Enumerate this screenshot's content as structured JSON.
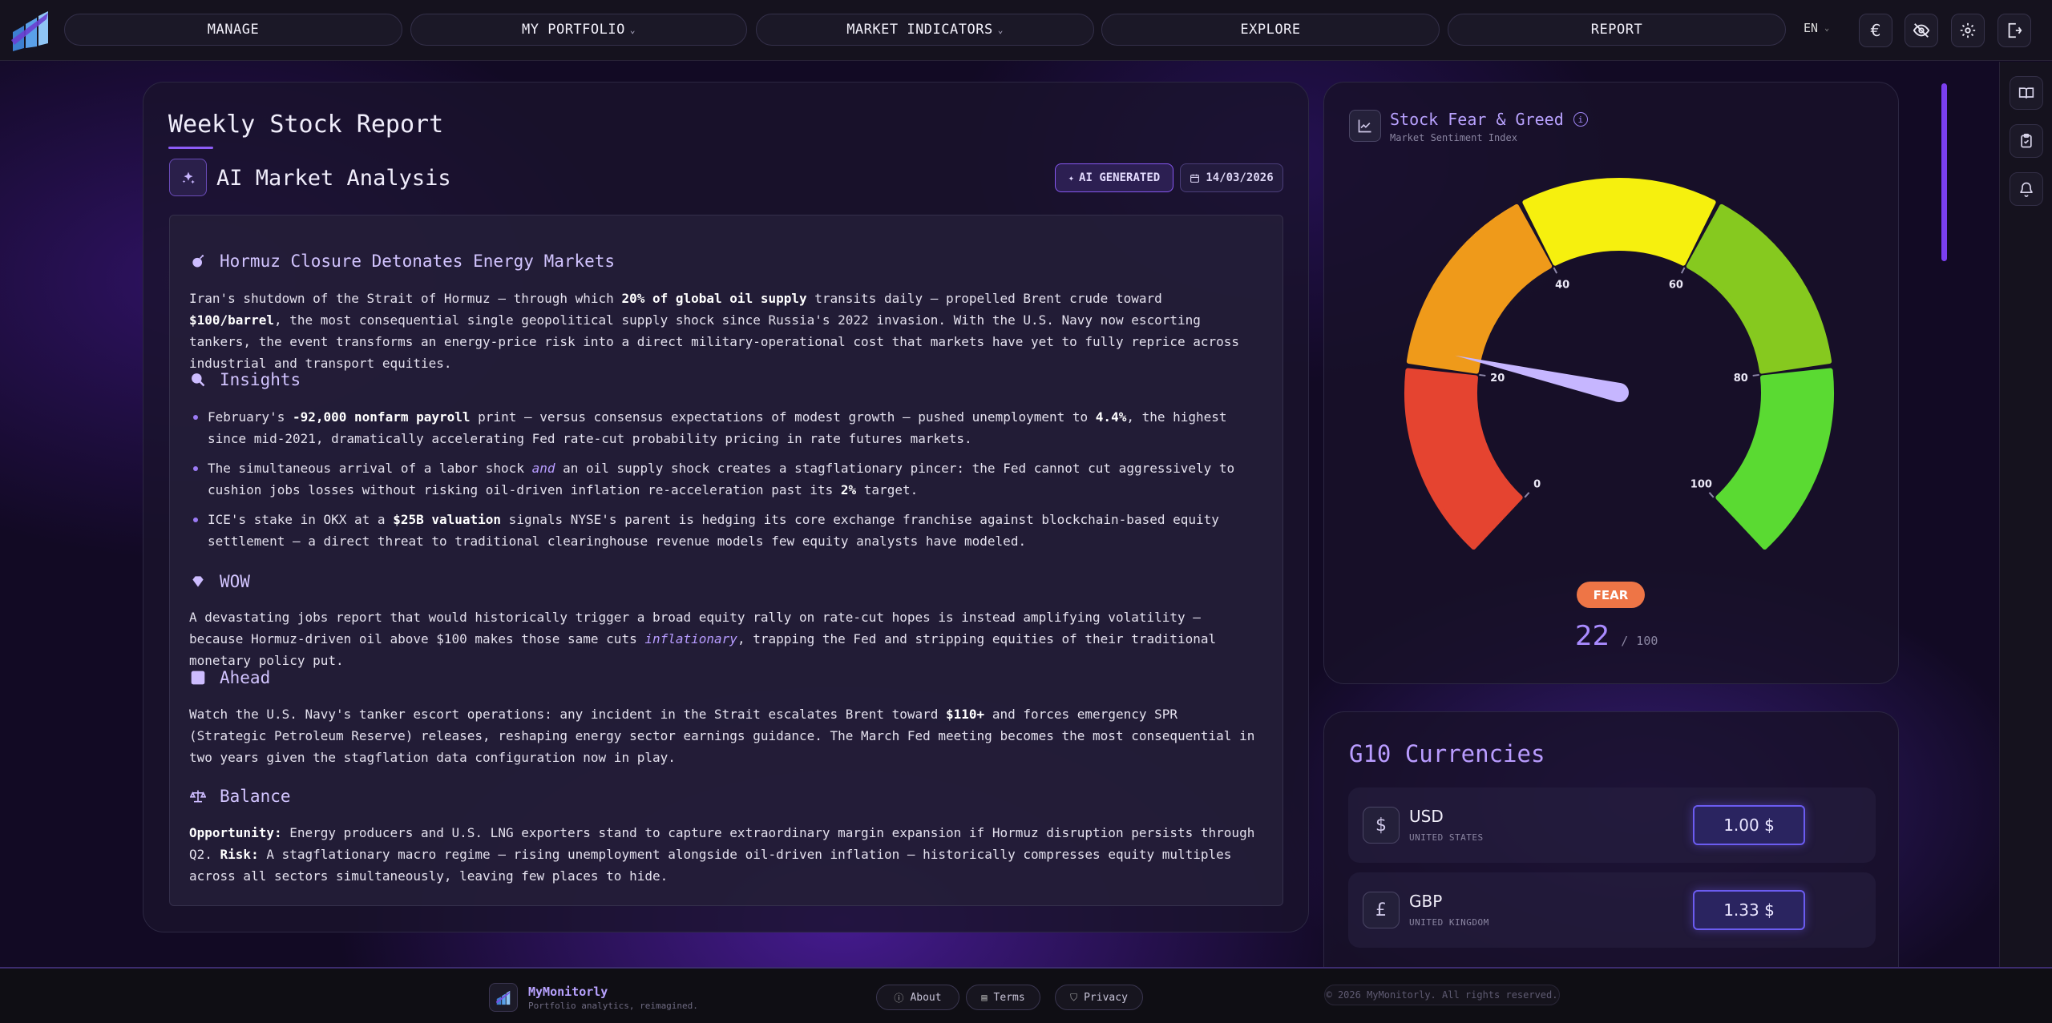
{
  "nav": {
    "items": [
      {
        "label": "MANAGE",
        "dropdown": false
      },
      {
        "label": "MY PORTFOLIO",
        "dropdown": true
      },
      {
        "label": "MARKET INDICATORS",
        "dropdown": true
      },
      {
        "label": "EXPLORE",
        "dropdown": false
      },
      {
        "label": "REPORT",
        "dropdown": false
      }
    ],
    "language": "EN",
    "currency_symbol": "€",
    "icons": [
      "euro-icon",
      "eye-off-icon",
      "gear-icon",
      "logout-icon"
    ]
  },
  "rail": {
    "icons": [
      "book-icon",
      "clipboard-icon",
      "bell-icon"
    ]
  },
  "report": {
    "title": "Weekly Stock Report",
    "subtitle": "AI Market Analysis",
    "badge_ai": "AI GENERATED",
    "badge_date": "14/03/2026",
    "sections": {
      "headline": {
        "title": "Hormuz Closure Detonates Energy Markets",
        "p1": "Iran's shutdown of the Strait of Hormuz — through which ",
        "b1": "20% of global oil supply",
        "p2": " transits daily — propelled Brent crude toward ",
        "b2": "$100/barrel",
        "p3": ", the most consequential single geopolitical supply shock since Russia's 2022 invasion. With the U.S. Navy now escorting tankers, the event transforms an energy-price risk into a direct military-operational cost that markets have yet to fully reprice across industrial and transport equities."
      },
      "insights": {
        "title": "Insights",
        "i1_a": "February's ",
        "i1_b": "-92,000 nonfarm payroll",
        "i1_c": " print — versus consensus expectations of modest growth — pushed unemployment to ",
        "i1_d": "4.4%",
        "i1_e": ", the highest since mid-2021, dramatically accelerating Fed rate-cut probability pricing in rate futures markets.",
        "i2_a": "The simultaneous arrival of a labor shock ",
        "i2_b": "and",
        "i2_c": " an oil supply shock creates a stagflationary pincer: the Fed cannot cut aggressively to cushion jobs losses without risking oil-driven inflation re-acceleration past its ",
        "i2_d": "2%",
        "i2_e": " target.",
        "i3_a": "ICE's stake in OKX at a ",
        "i3_b": "$25B valuation",
        "i3_c": " signals NYSE's parent is hedging its core exchange franchise against blockchain-based equity settlement — a direct threat to traditional clearinghouse revenue models few equity analysts have modeled."
      },
      "wow": {
        "title": "WOW",
        "p1": "A devastating jobs report that would historically trigger a broad equity rally on rate-cut hopes is instead amplifying volatility — because Hormuz-driven oil above $100 makes those same cuts ",
        "em": "inflationary",
        "p2": ", trapping the Fed and stripping equities of their traditional monetary policy put."
      },
      "ahead": {
        "title": "Ahead",
        "p1": "Watch the U.S. Navy's tanker escort operations: any incident in the Strait escalates Brent toward ",
        "b1": "$110+",
        "p2": " and forces emergency SPR (Strategic Petroleum Reserve) releases, reshaping energy sector earnings guidance. The March Fed meeting becomes the most consequential in two years given the stagflation data configuration now in play."
      },
      "balance": {
        "title": "Balance",
        "b1": "Opportunity:",
        "p1": " Energy producers and U.S. LNG exporters stand to capture extraordinary margin expansion if Hormuz disruption persists through Q2. ",
        "b2": "Risk:",
        "p2": " A stagflationary macro regime — rising unemployment alongside oil-driven inflation — historically compresses equity multiples across all sectors simultaneously, leaving few places to hide."
      }
    }
  },
  "fear_greed": {
    "title": "Stock Fear & Greed",
    "subtitle": "Market Sentiment Index",
    "value": 22,
    "max": 100,
    "max_label": "100",
    "label": "FEAR",
    "label_color": "#ee7546",
    "ticks": [
      "0",
      "20",
      "40",
      "60",
      "80",
      "100"
    ],
    "segment_colors": [
      "#e54430",
      "#ef9a1a",
      "#f6f00e",
      "#86c91f",
      "#5ada32"
    ],
    "needle_color": "#c6b6ff"
  },
  "currencies": {
    "title": "G10 Currencies",
    "items": [
      {
        "symbol": "$",
        "code": "USD",
        "name": "UNITED STATES",
        "value": "1.00 $"
      },
      {
        "symbol": "£",
        "code": "GBP",
        "name": "UNITED KINGDOM",
        "value": "1.33 $"
      }
    ]
  },
  "footer": {
    "brand": "MyMonitorly",
    "tagline": "Portfolio analytics, reimagined.",
    "links": [
      "About",
      "Terms",
      "Privacy"
    ],
    "copyright": "© 2026 MyMonitorly. All rights reserved."
  },
  "colors": {
    "accent": "#8d5cf6",
    "background": "#120a24",
    "panel": "#1a132c"
  }
}
